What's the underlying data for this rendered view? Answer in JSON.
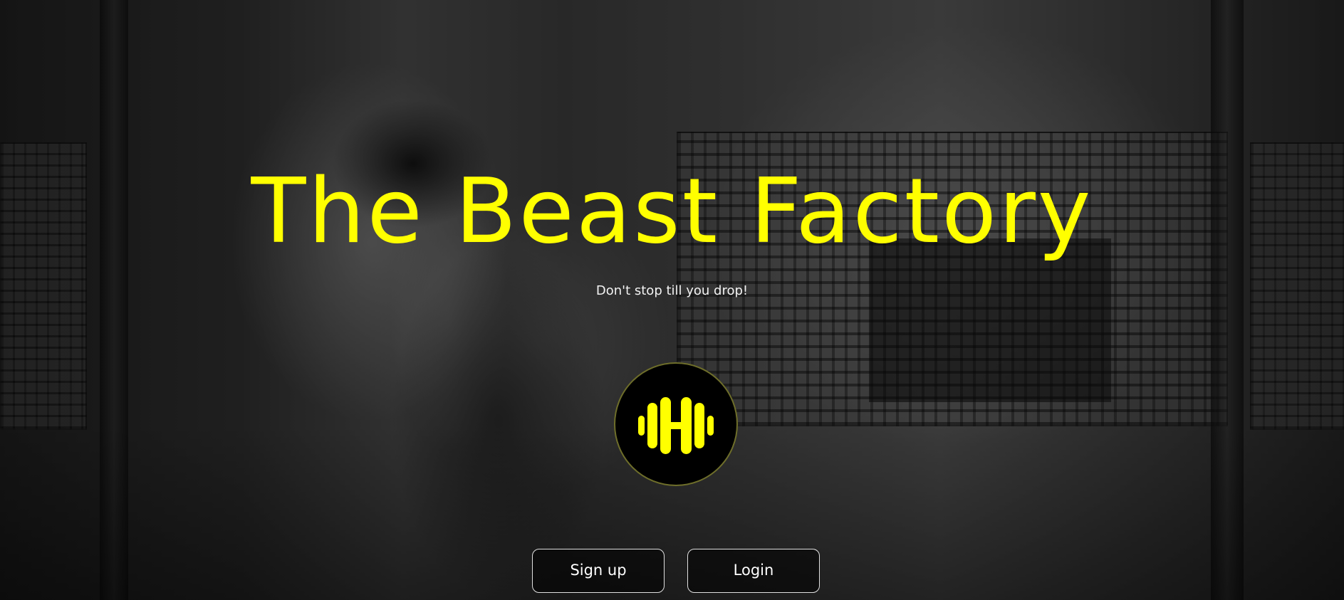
{
  "hero": {
    "title": "The Beast Factory",
    "tagline": "Don't stop till you drop!",
    "logo_icon": "dumbbell-icon",
    "accent_color": "#ffff00",
    "background_image": "black-and-white gym photo"
  },
  "actions": {
    "signup_label": "Sign up",
    "login_label": "Login"
  }
}
